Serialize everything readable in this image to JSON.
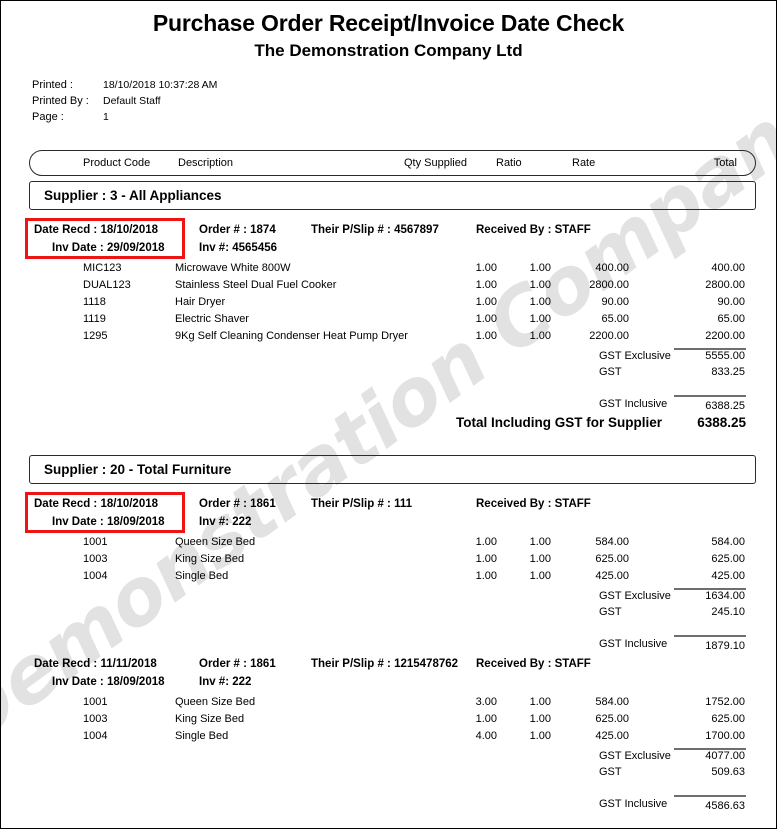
{
  "report": {
    "title": "Purchase Order Receipt/Invoice Date Check",
    "company": "The Demonstration Company Ltd",
    "watermark": "Demonstration Company",
    "highlight_color": "#ee1414"
  },
  "meta": {
    "printed_label": "Printed :",
    "printed_value": "18/10/2018 10:37:28 AM",
    "printed_by_label": "Printed By :",
    "printed_by_value": "Default Staff",
    "page_label": "Page :",
    "page_value": "1"
  },
  "columns": {
    "product_code": "Product Code",
    "description": "Description",
    "qty_supplied": "Qty Supplied",
    "ratio": "Ratio",
    "rate": "Rate",
    "total": "Total"
  },
  "totals_labels": {
    "gst_exclusive": "GST Exclusive",
    "gst": "GST",
    "gst_inclusive": "GST Inclusive",
    "supplier_total": "Total Including GST for Supplier"
  },
  "suppliers": [
    {
      "heading": "Supplier : 3 - All Appliances",
      "orders": [
        {
          "flagged": true,
          "date_recd": "Date Recd : 18/10/2018",
          "inv_date": "Inv Date : 29/09/2018",
          "order_no": "Order # : 1874",
          "inv_no": "Inv #: 4565456",
          "pslip": "Their P/Slip # : 4567897",
          "received_by": "Received By : STAFF",
          "lines": [
            {
              "code": "MIC123",
              "desc": "Microwave White 800W",
              "qty": "1.00",
              "ratio": "1.00",
              "rate": "400.00",
              "total": "400.00"
            },
            {
              "code": "DUAL123",
              "desc": "Stainless Steel Dual Fuel Cooker",
              "qty": "1.00",
              "ratio": "1.00",
              "rate": "2800.00",
              "total": "2800.00"
            },
            {
              "code": "1118",
              "desc": "Hair Dryer",
              "qty": "1.00",
              "ratio": "1.00",
              "rate": "90.00",
              "total": "90.00"
            },
            {
              "code": "1119",
              "desc": "Electric Shaver",
              "qty": "1.00",
              "ratio": "1.00",
              "rate": "65.00",
              "total": "65.00"
            },
            {
              "code": "1295",
              "desc": "9Kg Self Cleaning Condenser Heat Pump Dryer",
              "qty": "1.00",
              "ratio": "1.00",
              "rate": "2200.00",
              "total": "2200.00"
            }
          ],
          "gst_exclusive": "5555.00",
          "gst": "833.25",
          "gst_inclusive": "6388.25"
        }
      ],
      "supplier_total": "6388.25"
    },
    {
      "heading": "Supplier : 20 - Total Furniture",
      "orders": [
        {
          "flagged": true,
          "date_recd": "Date Recd : 18/10/2018",
          "inv_date": "Inv Date : 18/09/2018",
          "order_no": "Order # : 1861",
          "inv_no": "Inv #: 222",
          "pslip": "Their P/Slip # : 111",
          "received_by": "Received By : STAFF",
          "lines": [
            {
              "code": "1001",
              "desc": "Queen Size Bed",
              "qty": "1.00",
              "ratio": "1.00",
              "rate": "584.00",
              "total": "584.00"
            },
            {
              "code": "1003",
              "desc": "King Size Bed",
              "qty": "1.00",
              "ratio": "1.00",
              "rate": "625.00",
              "total": "625.00"
            },
            {
              "code": "1004",
              "desc": "Single Bed",
              "qty": "1.00",
              "ratio": "1.00",
              "rate": "425.00",
              "total": "425.00"
            }
          ],
          "gst_exclusive": "1634.00",
          "gst": "245.10",
          "gst_inclusive": "1879.10"
        },
        {
          "flagged": false,
          "date_recd": "Date Recd : 11/11/2018",
          "inv_date": "Inv Date : 18/09/2018",
          "order_no": "Order # : 1861",
          "inv_no": "Inv #: 222",
          "pslip": "Their P/Slip # : 1215478762",
          "received_by": "Received By : STAFF",
          "lines": [
            {
              "code": "1001",
              "desc": "Queen Size Bed",
              "qty": "3.00",
              "ratio": "1.00",
              "rate": "584.00",
              "total": "1752.00"
            },
            {
              "code": "1003",
              "desc": "King Size Bed",
              "qty": "1.00",
              "ratio": "1.00",
              "rate": "625.00",
              "total": "625.00"
            },
            {
              "code": "1004",
              "desc": "Single Bed",
              "qty": "4.00",
              "ratio": "1.00",
              "rate": "425.00",
              "total": "1700.00"
            }
          ],
          "gst_exclusive": "4077.00",
          "gst": "509.63",
          "gst_inclusive": "4586.63"
        }
      ],
      "supplier_total": null
    }
  ]
}
